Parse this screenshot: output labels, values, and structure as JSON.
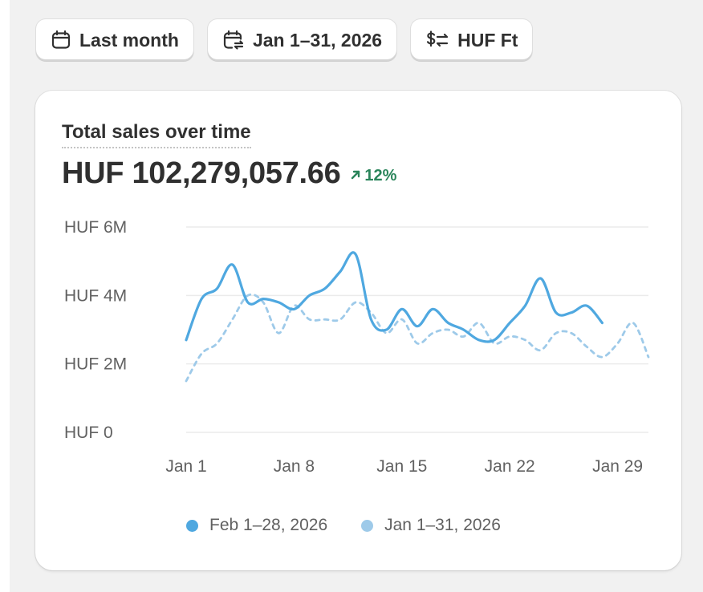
{
  "filters": {
    "period_label": "Last month",
    "date_range_label": "Jan 1–31, 2026",
    "currency_label": "HUF Ft"
  },
  "card": {
    "title": "Total sales over time",
    "total": "HUF 102,279,057.66",
    "change": "12%"
  },
  "colors": {
    "primary_series": "#4fa8e0",
    "comparison_series": "#9ecae9",
    "change_positive": "#29845a"
  },
  "icons": {
    "period": "calendar-icon",
    "date_range": "calendar-compare-icon",
    "currency": "currency-exchange-icon",
    "change": "arrow-up-right-icon"
  },
  "chart_data": {
    "type": "line",
    "title": "Total sales over time",
    "y_ticks": [
      "HUF 0",
      "HUF 2M",
      "HUF 4M",
      "HUF 6M"
    ],
    "ylim": [
      0,
      6000000
    ],
    "x_ticks": [
      "Jan 1",
      "Jan 8",
      "Jan 15",
      "Jan 22",
      "Jan 29"
    ],
    "grid": true,
    "legend": "bottom",
    "series": [
      {
        "name": "Feb 1–28, 2026",
        "style": "solid",
        "values": [
          2700000,
          3900000,
          4200000,
          4900000,
          3800000,
          3900000,
          3800000,
          3600000,
          4000000,
          4200000,
          4700000,
          5200000,
          3300000,
          3000000,
          3600000,
          3100000,
          3600000,
          3200000,
          3000000,
          2700000,
          2700000,
          3200000,
          3700000,
          4500000,
          3500000,
          3500000,
          3700000,
          3200000
        ]
      },
      {
        "name": "Jan 1–31, 2026",
        "style": "dashed",
        "values": [
          1500000,
          2300000,
          2600000,
          3300000,
          4000000,
          3800000,
          2900000,
          3700000,
          3300000,
          3300000,
          3300000,
          3800000,
          3500000,
          2900000,
          3300000,
          2600000,
          2900000,
          3000000,
          2800000,
          3200000,
          2600000,
          2800000,
          2700000,
          2400000,
          2900000,
          2900000,
          2500000,
          2200000,
          2600000,
          3200000,
          2200000
        ]
      }
    ]
  }
}
